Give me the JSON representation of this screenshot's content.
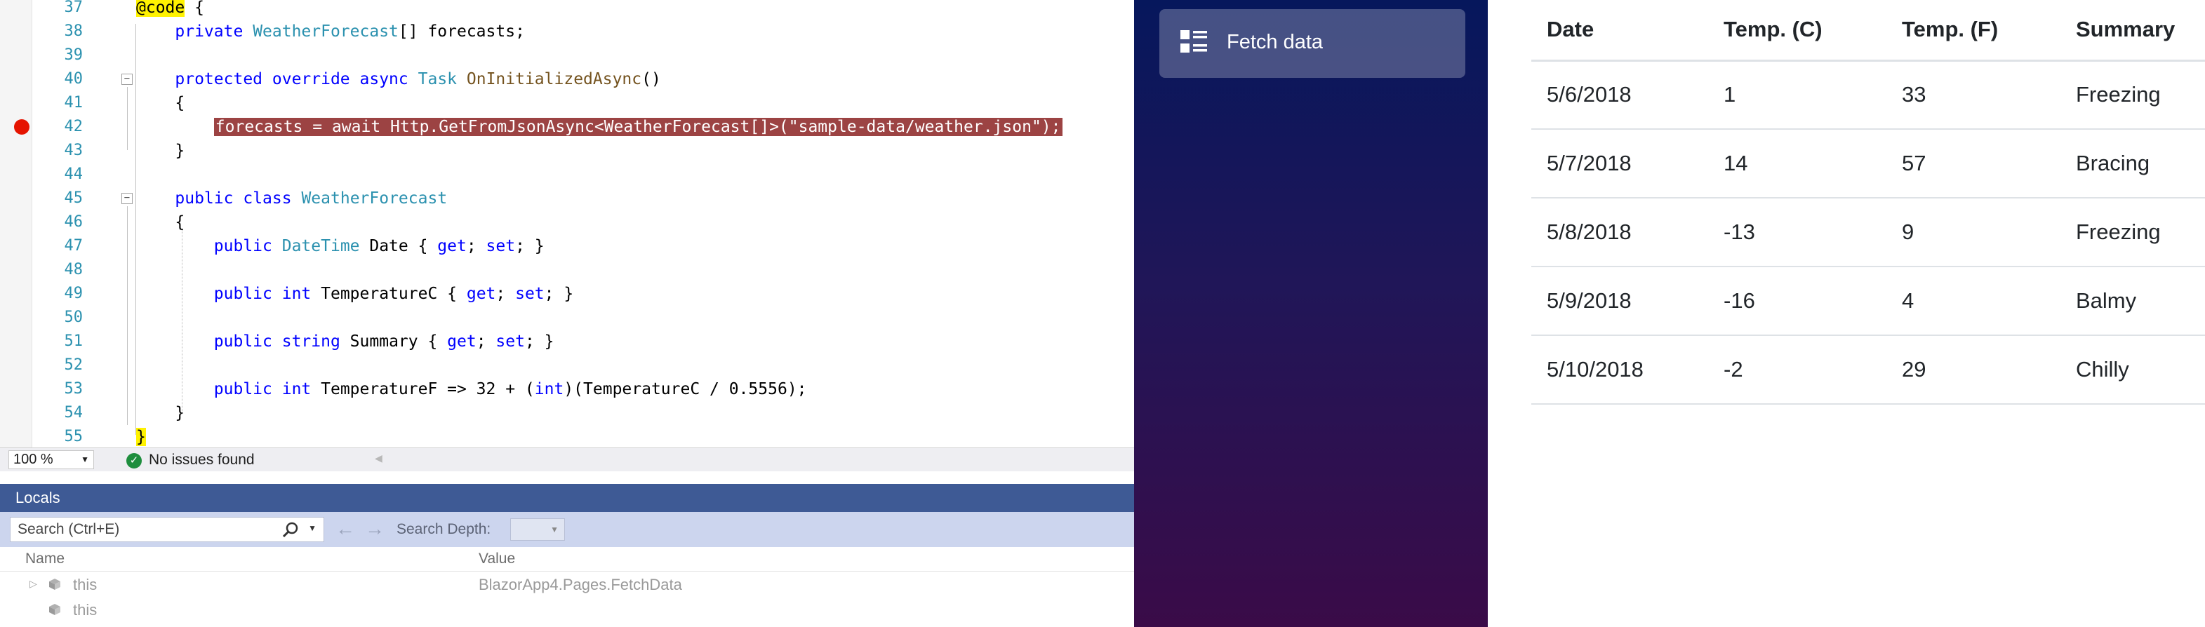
{
  "editor": {
    "lines": [
      {
        "n": "37",
        "segs": [
          {
            "t": "@code",
            "c": "hl-yellow"
          },
          {
            "t": " {",
            "c": ""
          }
        ]
      },
      {
        "n": "38",
        "segs": [
          {
            "t": "    ",
            "c": ""
          },
          {
            "t": "private",
            "c": "kw"
          },
          {
            "t": " ",
            "c": ""
          },
          {
            "t": "WeatherForecast",
            "c": "ty"
          },
          {
            "t": "[] forecasts;",
            "c": ""
          }
        ]
      },
      {
        "n": "39",
        "segs": []
      },
      {
        "n": "40",
        "segs": [
          {
            "t": "    ",
            "c": ""
          },
          {
            "t": "protected",
            "c": "kw"
          },
          {
            "t": " ",
            "c": ""
          },
          {
            "t": "override",
            "c": "kw"
          },
          {
            "t": " ",
            "c": ""
          },
          {
            "t": "async",
            "c": "kw"
          },
          {
            "t": " ",
            "c": ""
          },
          {
            "t": "Task",
            "c": "ty"
          },
          {
            "t": " ",
            "c": ""
          },
          {
            "t": "OnInitializedAsync",
            "c": "mt"
          },
          {
            "t": "()",
            "c": ""
          }
        ]
      },
      {
        "n": "41",
        "segs": [
          {
            "t": "    {",
            "c": ""
          }
        ]
      },
      {
        "n": "42",
        "segs": [
          {
            "t": "        ",
            "c": ""
          },
          {
            "t": "forecasts = await Http.GetFromJsonAsync<WeatherForecast[]>(\"sample-data/weather.json\");",
            "c": "hl-bp"
          }
        ]
      },
      {
        "n": "43",
        "segs": [
          {
            "t": "    }",
            "c": ""
          }
        ]
      },
      {
        "n": "44",
        "segs": []
      },
      {
        "n": "45",
        "segs": [
          {
            "t": "    ",
            "c": ""
          },
          {
            "t": "public",
            "c": "kw"
          },
          {
            "t": " ",
            "c": ""
          },
          {
            "t": "class",
            "c": "kw"
          },
          {
            "t": " ",
            "c": ""
          },
          {
            "t": "WeatherForecast",
            "c": "ty"
          }
        ]
      },
      {
        "n": "46",
        "segs": [
          {
            "t": "    {",
            "c": ""
          }
        ]
      },
      {
        "n": "47",
        "segs": [
          {
            "t": "        ",
            "c": ""
          },
          {
            "t": "public",
            "c": "kw"
          },
          {
            "t": " ",
            "c": ""
          },
          {
            "t": "DateTime",
            "c": "ty"
          },
          {
            "t": " Date { ",
            "c": ""
          },
          {
            "t": "get",
            "c": "kw"
          },
          {
            "t": "; ",
            "c": ""
          },
          {
            "t": "set",
            "c": "kw"
          },
          {
            "t": "; }",
            "c": ""
          }
        ]
      },
      {
        "n": "48",
        "segs": []
      },
      {
        "n": "49",
        "segs": [
          {
            "t": "        ",
            "c": ""
          },
          {
            "t": "public",
            "c": "kw"
          },
          {
            "t": " ",
            "c": ""
          },
          {
            "t": "int",
            "c": "kw"
          },
          {
            "t": " TemperatureC { ",
            "c": ""
          },
          {
            "t": "get",
            "c": "kw"
          },
          {
            "t": "; ",
            "c": ""
          },
          {
            "t": "set",
            "c": "kw"
          },
          {
            "t": "; }",
            "c": ""
          }
        ]
      },
      {
        "n": "50",
        "segs": []
      },
      {
        "n": "51",
        "segs": [
          {
            "t": "        ",
            "c": ""
          },
          {
            "t": "public",
            "c": "kw"
          },
          {
            "t": " ",
            "c": ""
          },
          {
            "t": "string",
            "c": "kw"
          },
          {
            "t": " Summary { ",
            "c": ""
          },
          {
            "t": "get",
            "c": "kw"
          },
          {
            "t": "; ",
            "c": ""
          },
          {
            "t": "set",
            "c": "kw"
          },
          {
            "t": "; }",
            "c": ""
          }
        ]
      },
      {
        "n": "52",
        "segs": []
      },
      {
        "n": "53",
        "segs": [
          {
            "t": "        ",
            "c": ""
          },
          {
            "t": "public",
            "c": "kw"
          },
          {
            "t": " ",
            "c": ""
          },
          {
            "t": "int",
            "c": "kw"
          },
          {
            "t": " TemperatureF => 32 + (",
            "c": ""
          },
          {
            "t": "int",
            "c": "kw"
          },
          {
            "t": ")(TemperatureC / 0.5556);",
            "c": ""
          }
        ]
      },
      {
        "n": "54",
        "segs": [
          {
            "t": "    }",
            "c": ""
          }
        ]
      },
      {
        "n": "55",
        "segs": [
          {
            "t": "}",
            "c": "hl-yellow"
          }
        ]
      }
    ]
  },
  "status_bar": {
    "zoom": "100 %",
    "issues": "No issues found"
  },
  "locals": {
    "title": "Locals",
    "search_placeholder": "Search (Ctrl+E)",
    "search_depth_label": "Search Depth:",
    "columns": {
      "name": "Name",
      "value": "Value"
    },
    "rows": [
      {
        "name": "this",
        "value": "BlazorApp4.Pages.FetchData"
      },
      {
        "name": "this",
        "value": ""
      }
    ]
  },
  "sidebar": {
    "nav_item_label": "Fetch data"
  },
  "weather": {
    "headers": [
      "Date",
      "Temp. (C)",
      "Temp. (F)",
      "Summary"
    ],
    "rows": [
      [
        "5/6/2018",
        "1",
        "33",
        "Freezing"
      ],
      [
        "5/7/2018",
        "14",
        "57",
        "Bracing"
      ],
      [
        "5/8/2018",
        "-13",
        "9",
        "Freezing"
      ],
      [
        "5/9/2018",
        "-16",
        "4",
        "Balmy"
      ],
      [
        "5/10/2018",
        "-2",
        "29",
        "Chilly"
      ]
    ]
  },
  "colors": {
    "breakpoint": "#e51400",
    "breakpoint_highlight": "#9c4343",
    "locals_header": "#3e5a95",
    "sidebar_top": "#06175c",
    "sidebar_bottom": "#3a0b48"
  }
}
